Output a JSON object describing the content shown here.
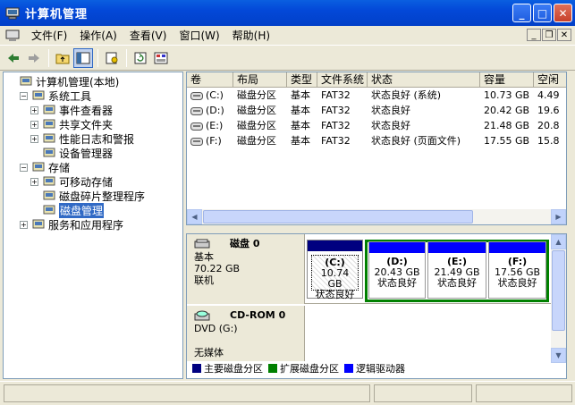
{
  "window": {
    "title": "计算机管理"
  },
  "menu": [
    "文件(F)",
    "操作(A)",
    "查看(V)",
    "窗口(W)",
    "帮助(H)"
  ],
  "tree": [
    {
      "label": "计算机管理(本地)",
      "level": 0,
      "exp": "",
      "icon": "computer-icon"
    },
    {
      "label": "系统工具",
      "level": 1,
      "exp": "-",
      "icon": "tools-icon"
    },
    {
      "label": "事件查看器",
      "level": 2,
      "exp": "+",
      "icon": "event-viewer-icon"
    },
    {
      "label": "共享文件夹",
      "level": 2,
      "exp": "+",
      "icon": "shared-folder-icon"
    },
    {
      "label": "性能日志和警报",
      "level": 2,
      "exp": "+",
      "icon": "performance-icon"
    },
    {
      "label": "设备管理器",
      "level": 2,
      "exp": "",
      "icon": "device-manager-icon"
    },
    {
      "label": "存储",
      "level": 1,
      "exp": "-",
      "icon": "storage-icon"
    },
    {
      "label": "可移动存储",
      "level": 2,
      "exp": "+",
      "icon": "removable-storage-icon"
    },
    {
      "label": "磁盘碎片整理程序",
      "level": 2,
      "exp": "",
      "icon": "defrag-icon"
    },
    {
      "label": "磁盘管理",
      "level": 2,
      "exp": "",
      "icon": "disk-management-icon",
      "selected": true
    },
    {
      "label": "服务和应用程序",
      "level": 1,
      "exp": "+",
      "icon": "services-icon"
    }
  ],
  "volumes": {
    "columns": [
      "卷",
      "布局",
      "类型",
      "文件系统",
      "状态",
      "容量",
      "空闲"
    ],
    "rows": [
      [
        "(C:)",
        "磁盘分区",
        "基本",
        "FAT32",
        "状态良好 (系统)",
        "10.73 GB",
        "4.49"
      ],
      [
        "(D:)",
        "磁盘分区",
        "基本",
        "FAT32",
        "状态良好",
        "20.42 GB",
        "19.6"
      ],
      [
        "(E:)",
        "磁盘分区",
        "基本",
        "FAT32",
        "状态良好",
        "21.48 GB",
        "20.8"
      ],
      [
        "(F:)",
        "磁盘分区",
        "基本",
        "FAT32",
        "状态良好 (页面文件)",
        "17.55 GB",
        "15.8"
      ]
    ]
  },
  "disks": [
    {
      "name": "磁盘 0",
      "type": "基本",
      "size": "70.22 GB",
      "status": "联机",
      "partitions": [
        {
          "label": "(C:)",
          "size": "10.74 GB",
          "status": "状态良好"
        },
        {
          "label": "(D:)",
          "size": "20.43 GB",
          "status": "状态良好"
        },
        {
          "label": "(E:)",
          "size": "21.49 GB",
          "status": "状态良好"
        },
        {
          "label": "(F:)",
          "size": "17.56 GB",
          "status": "状态良好"
        }
      ]
    },
    {
      "name": "CD-ROM 0",
      "type": "DVD (G:)",
      "status": "无媒体"
    }
  ],
  "legend": [
    {
      "label": "主要磁盘分区",
      "color": "#000080"
    },
    {
      "label": "扩展磁盘分区",
      "color": "#008000"
    },
    {
      "label": "逻辑驱动器",
      "color": "#0000ff"
    }
  ]
}
